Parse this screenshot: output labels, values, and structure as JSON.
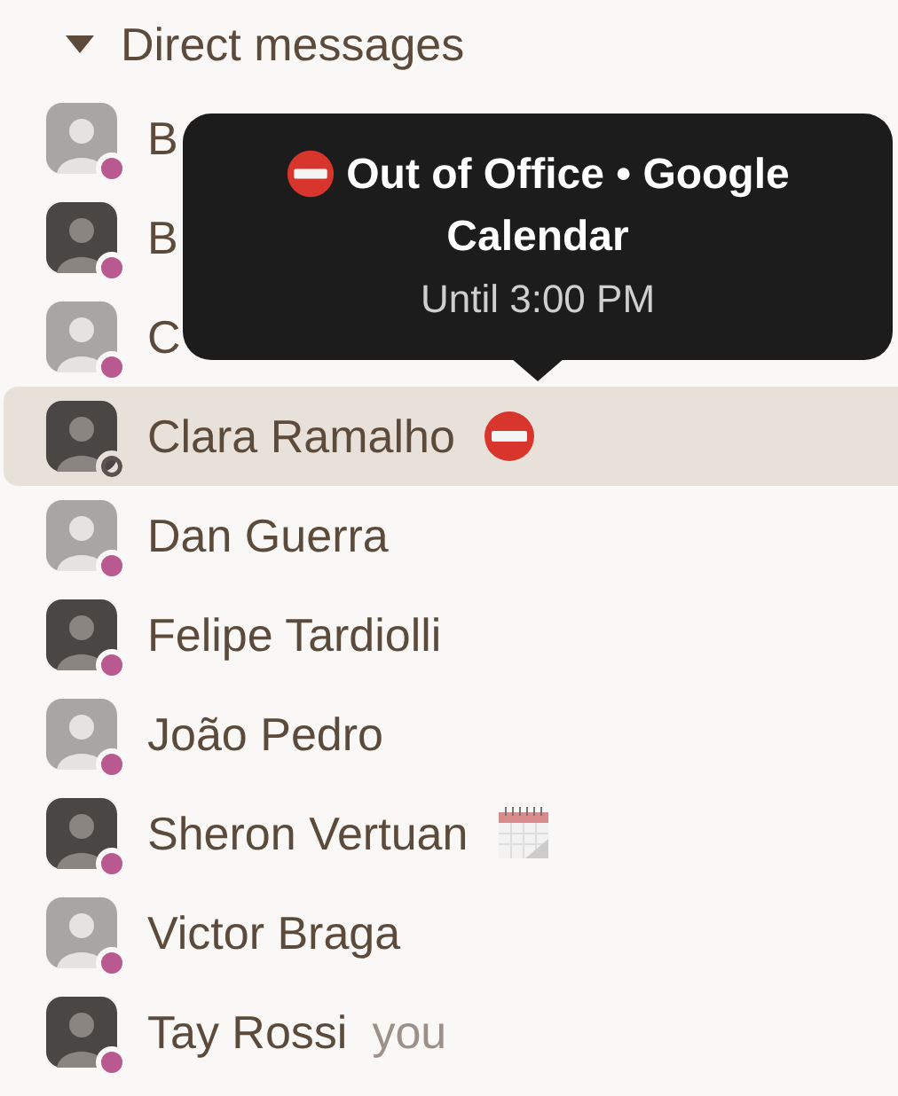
{
  "section": {
    "title": "Direct messages",
    "expanded": true
  },
  "contacts": [
    {
      "name": "B",
      "away": false,
      "selected": false
    },
    {
      "name": "B",
      "away": false,
      "selected": false
    },
    {
      "name": "C",
      "away": false,
      "selected": false
    },
    {
      "name": "Clara Ramalho",
      "away": true,
      "selected": true,
      "status": {
        "kind": "no-entry"
      }
    },
    {
      "name": "Dan Guerra",
      "away": false,
      "selected": false
    },
    {
      "name": "Felipe Tardiolli",
      "away": false,
      "selected": false
    },
    {
      "name": "João Pedro",
      "away": false,
      "selected": false
    },
    {
      "name": "Sheron Vertuan",
      "away": false,
      "selected": false,
      "status": {
        "kind": "calendar"
      }
    },
    {
      "name": "Victor Braga",
      "away": false,
      "selected": false
    },
    {
      "name": "Tay Rossi",
      "away": false,
      "selected": false,
      "suffix": "you"
    }
  ],
  "tooltip": {
    "icon": {
      "kind": "no-entry"
    },
    "title": "Out of Office • Google Calendar",
    "subtitle": "Until 3:00 PM"
  }
}
